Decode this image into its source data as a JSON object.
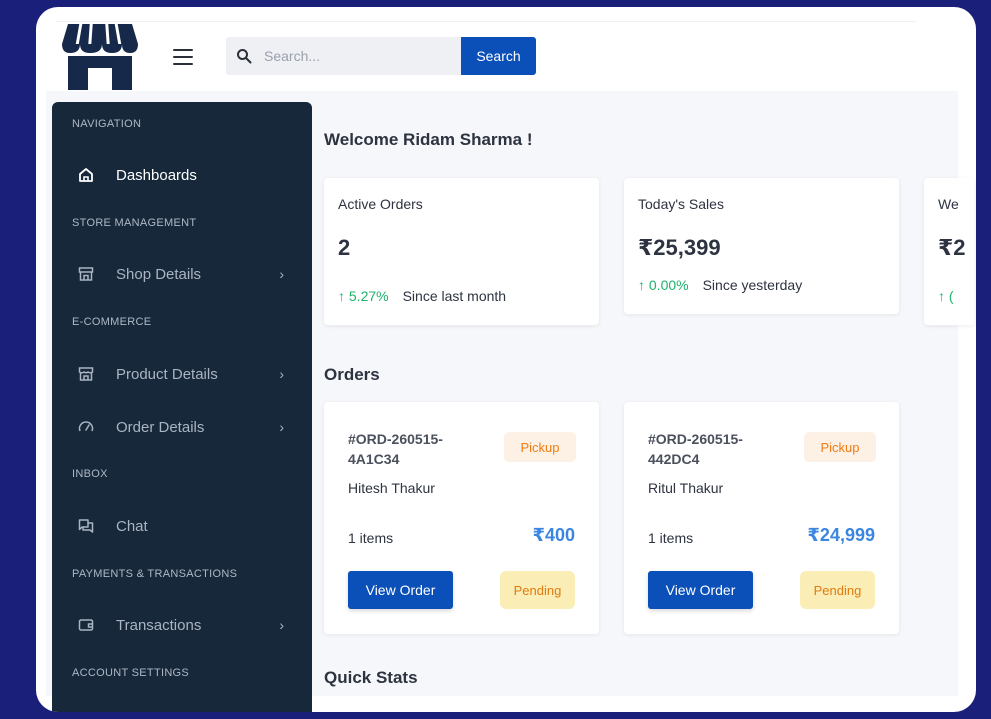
{
  "header": {
    "search_placeholder": "Search...",
    "search_button": "Search"
  },
  "sidebar": {
    "sections": [
      {
        "heading": "NAVIGATION",
        "items": [
          {
            "label": "Dashboards",
            "icon": "home-icon",
            "active": true
          }
        ]
      },
      {
        "heading": "STORE MANAGEMENT",
        "items": [
          {
            "label": "Shop Details",
            "icon": "store-icon",
            "has_submenu": true
          }
        ]
      },
      {
        "heading": "E-COMMERCE",
        "items": [
          {
            "label": "Product Details",
            "icon": "shop-icon",
            "has_submenu": true
          },
          {
            "label": "Order Details",
            "icon": "gauge-icon",
            "has_submenu": true
          }
        ]
      },
      {
        "heading": "INBOX",
        "items": [
          {
            "label": "Chat",
            "icon": "chat-icon"
          }
        ]
      },
      {
        "heading": "PAYMENTS & TRANSACTIONS",
        "items": [
          {
            "label": "Transactions",
            "icon": "wallet-icon",
            "has_submenu": true
          }
        ]
      },
      {
        "heading": "ACCOUNT SETTINGS",
        "items": []
      }
    ]
  },
  "main": {
    "welcome": "Welcome Ridam Sharma !",
    "stats": [
      {
        "title": "Active Orders",
        "value": "2",
        "change": "5.27%",
        "since": "Since last month"
      },
      {
        "title": "Today's Sales",
        "value": "₹25,399",
        "change": "0.00%",
        "since": "Since yesterday"
      },
      {
        "title": "We",
        "value": "₹2",
        "change": "(",
        "since": ""
      }
    ],
    "orders_title": "Orders",
    "orders": [
      {
        "id": "#ORD-260515-4A1C34",
        "type": "Pickup",
        "customer": "Hitesh Thakur",
        "items": "1 items",
        "total": "₹400",
        "view_label": "View Order",
        "status": "Pending"
      },
      {
        "id": "#ORD-260515-442DC4",
        "type": "Pickup",
        "customer": "Ritul Thakur",
        "items": "1 items",
        "total": "₹24,999",
        "view_label": "View Order",
        "status": "Pending"
      }
    ],
    "quick_stats_title": "Quick Stats"
  },
  "colors": {
    "background": "#1a1f7a",
    "sidebar": "#16283a",
    "primary": "#0b4fb8",
    "positive": "#1fb36b",
    "price": "#3a86e0",
    "pickup": "#f07c12",
    "pending_bg": "#faedb5"
  }
}
